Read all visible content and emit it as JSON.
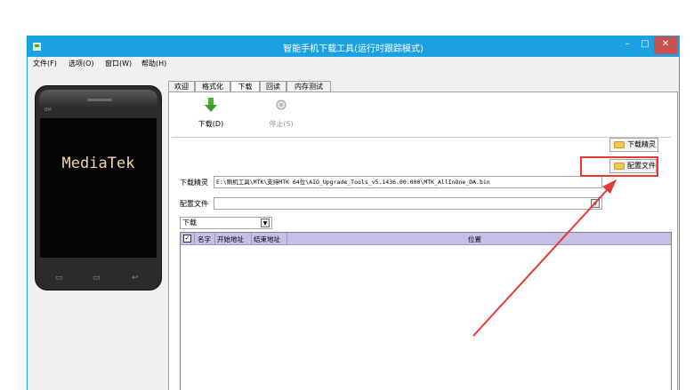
{
  "window": {
    "title": "智能手机下载工具(运行时跟踪模式)",
    "min_label": "–",
    "max_label": "□",
    "close_label": "✕"
  },
  "menu": {
    "items": [
      {
        "label": "文件(F)"
      },
      {
        "label": "选项(O)"
      },
      {
        "label": "窗口(W)"
      },
      {
        "label": "帮助(H)"
      }
    ]
  },
  "phone": {
    "brand": "BM",
    "logo": "MediaTek",
    "nav_menu": "▭",
    "nav_home": "▭",
    "nav_back": "↩"
  },
  "tabs": [
    {
      "label": "欢迎"
    },
    {
      "label": "格式化"
    },
    {
      "label": "下载"
    },
    {
      "label": "回读"
    },
    {
      "label": "内存测试"
    }
  ],
  "toolbar": {
    "download_label": "下载(D)",
    "stop_label": "停止(S)"
  },
  "download_agent": {
    "label": "下载精灵",
    "value": "E:\\刷机工具\\MTK\\支持MTK 64位\\AIO_Upgrade_Tools_v5.1436.00.000\\MTK_AllInOne_DA.bin",
    "button_label": "下载精灵"
  },
  "scatter_file": {
    "label": "配置文件",
    "value": "",
    "button_label": "配置文件"
  },
  "mode_select": {
    "value": "下载"
  },
  "table": {
    "check_mark": "✓",
    "columns": [
      "名字",
      "开始地址",
      "结束地址",
      "位置"
    ]
  },
  "colors": {
    "titlebar": "#1ba1e2",
    "close_button": "#c75050",
    "table_header": "#c5c0e8",
    "highlight": "#e53935",
    "phone_logo": "#f0d8a8"
  }
}
